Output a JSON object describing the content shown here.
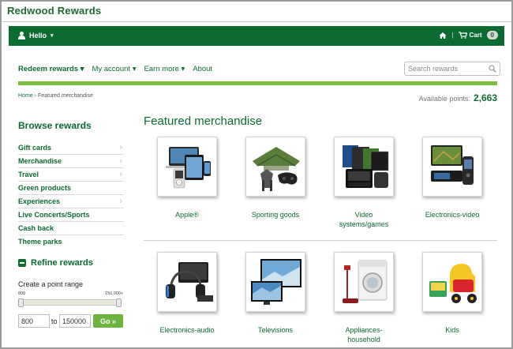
{
  "brand": {
    "name": "Redwood Rewards"
  },
  "topbar": {
    "greeting": "Hello",
    "cart_label": "Cart",
    "cart_count": "0",
    "separator": "|"
  },
  "nav": {
    "items": [
      {
        "label": "Redeem rewards"
      },
      {
        "label": "My account"
      },
      {
        "label": "Earn more"
      },
      {
        "label": "About"
      }
    ]
  },
  "search": {
    "placeholder": "Search rewards"
  },
  "breadcrumb": {
    "home": "Home",
    "separator": "›",
    "current": "Featured merchandise"
  },
  "points": {
    "label": "Available points:",
    "value": "2,663"
  },
  "sidebar": {
    "title": "Browse rewards",
    "items": [
      {
        "label": "Gift cards",
        "has_submenu": true
      },
      {
        "label": "Merchandise",
        "has_submenu": true
      },
      {
        "label": "Travel",
        "has_submenu": true
      },
      {
        "label": "Green products",
        "has_submenu": false
      },
      {
        "label": "Experiences",
        "has_submenu": true
      },
      {
        "label": "Live Concerts/Sports",
        "has_submenu": false
      },
      {
        "label": "Cash back",
        "has_submenu": false
      },
      {
        "label": "Theme parks",
        "has_submenu": false
      }
    ]
  },
  "refine": {
    "title": "Refine rewards",
    "range_label": "Create a point range",
    "slider_min_label": "800",
    "slider_max_label": "150,000+",
    "min_value": "800",
    "to_label": "to",
    "max_value": "150000",
    "go_label": "Go »"
  },
  "main": {
    "title": "Featured merchandise",
    "tiles": [
      {
        "label": "Apple®",
        "icon": "apple-products-icon"
      },
      {
        "label": "Sporting goods",
        "icon": "sporting-goods-icon"
      },
      {
        "label": "Video systems/games",
        "label_line1": "Video",
        "label_line2": "systems/games",
        "icon": "game-console-icon"
      },
      {
        "label": "Electronics-video",
        "icon": "gps-video-icon"
      },
      {
        "label": "Electronics-audio",
        "icon": "headphones-icon"
      },
      {
        "label": "Televisions",
        "icon": "television-icon"
      },
      {
        "label": "Appliances-household",
        "label_line1": "Appliances-",
        "label_line2": "household",
        "icon": "washer-icon"
      },
      {
        "label": "Kids",
        "icon": "toy-car-icon"
      }
    ]
  },
  "colors": {
    "brand_green": "#0b6b30",
    "accent_green": "#7dbf3d",
    "button_green": "#6db33f"
  }
}
